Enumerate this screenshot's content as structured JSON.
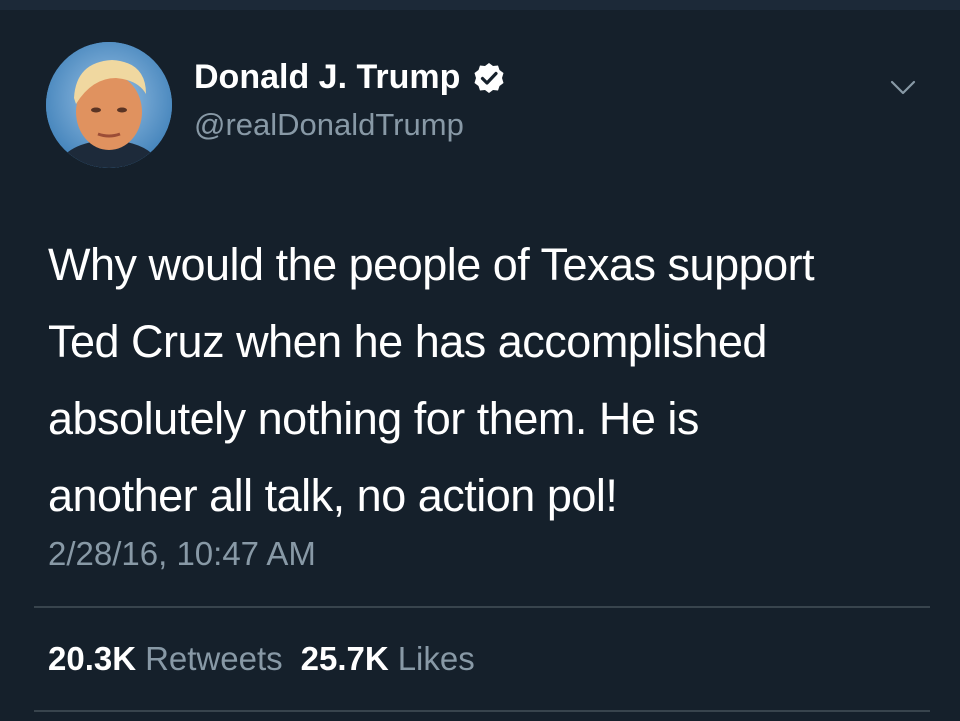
{
  "tweet": {
    "author": {
      "display_name": "Donald J. Trump",
      "handle": "@realDonaldTrump",
      "verified": true,
      "avatar_icon": "profile-photo"
    },
    "text_lines": [
      "Why would the people of Texas support",
      "Ted Cruz when he has accomplished",
      "absolutely nothing for them. He is",
      "another all talk, no action pol!"
    ],
    "timestamp": "2/28/16, 10:47 AM",
    "stats": {
      "retweets_count": "20.3K",
      "retweets_label": "Retweets",
      "likes_count": "25.7K",
      "likes_label": "Likes"
    },
    "menu_icon": "chevron-down-icon"
  },
  "colors": {
    "background": "#15202b",
    "primary_text": "#ffffff",
    "secondary_text": "#8899a6",
    "divider": "#38444d",
    "verified_badge": "#ffffff"
  }
}
